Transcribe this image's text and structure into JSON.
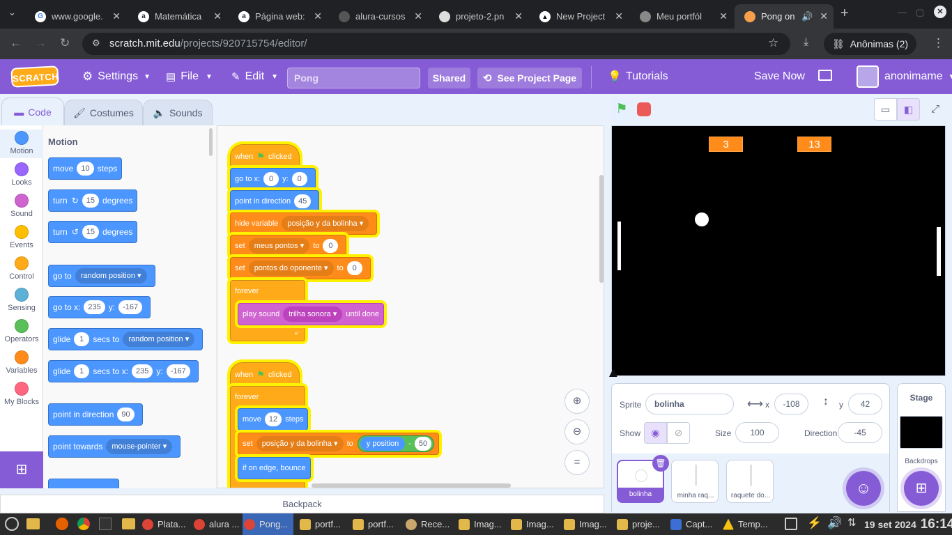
{
  "browser": {
    "tabs": [
      {
        "title": "www.google.",
        "fav": "G",
        "favcolor": "#4285f4"
      },
      {
        "title": "Matemática",
        "fav": "a",
        "favcolor": "#232f3e"
      },
      {
        "title": "Página web:",
        "fav": "a",
        "favcolor": "#232f3e"
      },
      {
        "title": "alura-cursos",
        "fav": "●",
        "favcolor": "#444"
      },
      {
        "title": "projeto-2.pn",
        "fav": "●",
        "favcolor": "#444"
      },
      {
        "title": "New Project",
        "fav": "▲",
        "favcolor": "#000"
      },
      {
        "title": "Meu portfól",
        "fav": "◍",
        "favcolor": "#555"
      },
      {
        "title": "Pong on",
        "fav": "◐",
        "favcolor": "#f7a04b"
      }
    ],
    "url_host": "scratch.mit.edu",
    "url_path": "/projects/920715754/editor/",
    "profile": "Anônimas (2)"
  },
  "menu": {
    "logo": "SCRATCH",
    "settings": "Settings",
    "file": "File",
    "edit": "Edit",
    "project_title": "Pong",
    "shared": "Shared",
    "see_project": "See Project Page",
    "tutorials": "Tutorials",
    "save_now": "Save Now",
    "username": "anonimame"
  },
  "editor_tabs": {
    "code": "Code",
    "costumes": "Costumes",
    "sounds": "Sounds"
  },
  "categories": [
    {
      "label": "Motion",
      "color": "#4c97ff"
    },
    {
      "label": "Looks",
      "color": "#9966ff"
    },
    {
      "label": "Sound",
      "color": "#cf63cf"
    },
    {
      "label": "Events",
      "color": "#ffbf00"
    },
    {
      "label": "Control",
      "color": "#ffab19"
    },
    {
      "label": "Sensing",
      "color": "#5cb1d6"
    },
    {
      "label": "Operators",
      "color": "#59c059"
    },
    {
      "label": "Variables",
      "color": "#ff8c1a"
    },
    {
      "label": "My Blocks",
      "color": "#ff6680"
    }
  ],
  "palette": {
    "heading": "Motion",
    "move": {
      "a": "move",
      "n": "10",
      "b": "steps"
    },
    "turn_right": {
      "a": "turn",
      "n": "15",
      "b": "degrees"
    },
    "turn_left": {
      "a": "turn",
      "n": "15",
      "b": "degrees"
    },
    "goto": {
      "a": "go to",
      "d": "random position"
    },
    "gotoxy": {
      "a": "go to x:",
      "x": "235",
      "b": "y:",
      "y": "-167"
    },
    "glide": {
      "a": "glide",
      "n": "1",
      "b": "secs to",
      "d": "random position"
    },
    "glidexy": {
      "a": "glide",
      "n": "1",
      "b": "secs to x:",
      "x": "235",
      "c": "y:",
      "y": "-167"
    },
    "point_dir": {
      "a": "point in direction",
      "n": "90"
    },
    "point_towards": {
      "a": "point towards",
      "d": "mouse-pointer"
    }
  },
  "script1": {
    "hat": {
      "a": "when",
      "b": "clicked"
    },
    "goto": {
      "a": "go to x:",
      "x": "0",
      "b": "y:",
      "y": "0"
    },
    "point": {
      "a": "point in direction",
      "n": "45"
    },
    "hide": {
      "a": "hide variable",
      "d": "posição y da bolinha"
    },
    "set1": {
      "a": "set",
      "d": "meus pontos",
      "b": "to",
      "n": "0"
    },
    "set2": {
      "a": "set",
      "d": "pontos do oponente",
      "b": "to",
      "n": "0"
    },
    "forever": "forever",
    "play": {
      "a": "play sound",
      "d": "trilha sonora",
      "b": "until done"
    }
  },
  "script2": {
    "hat": {
      "a": "when",
      "b": "clicked"
    },
    "forever": "forever",
    "move": {
      "a": "move",
      "n": "12",
      "b": "steps"
    },
    "set": {
      "a": "set",
      "d": "posição y da bolinha",
      "b": "to",
      "r": "y position",
      "op": "-",
      "n": "50"
    },
    "bounce": "if on edge, bounce"
  },
  "stage": {
    "score_left": "3",
    "score_right": "13"
  },
  "sprite_info": {
    "sprite_label": "Sprite",
    "sprite_name": "bolinha",
    "x_label": "x",
    "x": "-108",
    "y_label": "y",
    "y": "42",
    "show_label": "Show",
    "size_label": "Size",
    "size": "100",
    "direction_label": "Direction",
    "direction": "-45"
  },
  "sprites": [
    {
      "name": "bolinha"
    },
    {
      "name": "minha raq..."
    },
    {
      "name": "raquete do..."
    }
  ],
  "stage_panel": {
    "label": "Stage",
    "backdrops": "Backdrops"
  },
  "backpack": "Backpack",
  "taskbar": {
    "items": [
      "Plata...",
      "alura ...",
      "Pong...",
      "portf...",
      "portf...",
      "Rece...",
      "Imag...",
      "Imag...",
      "Imag...",
      "proje...",
      "Capt...",
      "Temp..."
    ],
    "date": "19 set 2024",
    "time": "16:14"
  }
}
